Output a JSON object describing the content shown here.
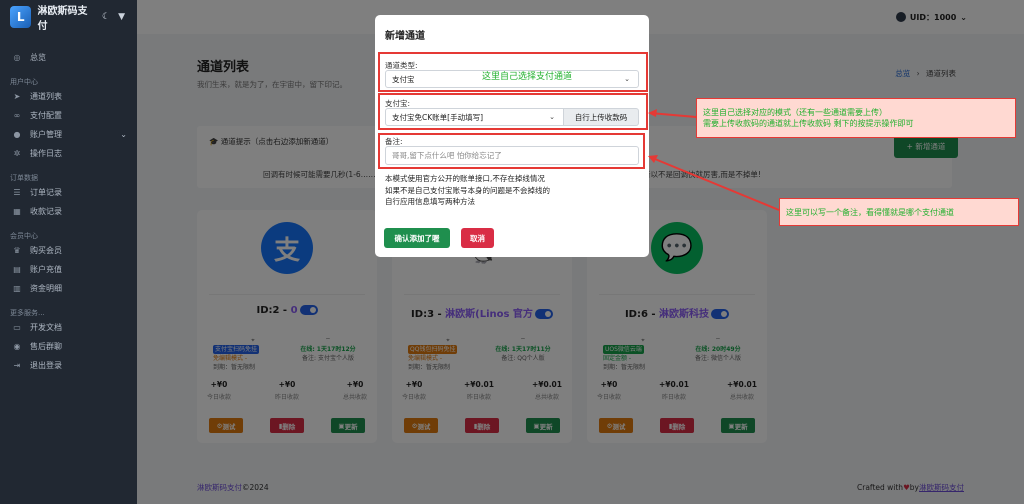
{
  "sidebar": {
    "brand": "淋欧斯码支付",
    "sections": [
      {
        "title": "用户中心",
        "items": [
          "通道列表",
          "支付配置",
          "账户管理",
          "操作日志"
        ]
      },
      {
        "title": "订单数据",
        "items": [
          "订单记录",
          "收款记录"
        ]
      },
      {
        "title": "会员中心",
        "items": [
          "购买会员",
          "账户充值",
          "资金明细"
        ]
      },
      {
        "title": "更多服务...",
        "items": [
          "开发文档",
          "售后群聊",
          "退出登录"
        ]
      }
    ],
    "home": "总览"
  },
  "topbar": {
    "uid": "UID：1000"
  },
  "page": {
    "title": "通道列表",
    "subtitle": "我们生来，就是为了，在宇宙中，留下印记。",
    "breadcrumb_home": "总览",
    "breadcrumb_current": "通道列表"
  },
  "notice": {
    "title": "通道提示（点击右边添加新通道）",
    "text": "回调有时候可能需要几秒(1-6…………………………………………………………………账号一些功能 而设定的时间,所以不是回调快就厉害,而是不掉单!",
    "add_button": "+ 新增通道"
  },
  "cards": [
    {
      "id_label": "ID:2 - ",
      "name": "0",
      "tag": "支付宝扫码免挂",
      "tag_color": "#2563eb",
      "sub1": "免编辑模式 -",
      "sub2": "到期：暂无限制",
      "online": "在线: 1天17时12分",
      "remark": "备注: 支付宝个人版",
      "today": "+¥0",
      "yesterday": "+¥0",
      "total": "+¥0",
      "logo": "支",
      "logo_color": "#1677ff"
    },
    {
      "id_label": "ID:3 - ",
      "name": "淋欧斯(Linos 官方",
      "tag": "QQ钱包扫码免挂",
      "tag_color": "#e07a0e",
      "sub1": "免编辑模式 -",
      "sub2": "到期：暂无限制",
      "online": "在线: 1天17时11分",
      "remark": "备注: QQ个人版",
      "today": "+¥0",
      "yesterday": "+¥0.01",
      "total": "+¥0.01",
      "logo": "",
      "logo_color": "#ffffff"
    },
    {
      "id_label": "ID:6 - ",
      "name": "淋欧斯科技",
      "tag": "UOS微信云端",
      "tag_color": "#16a34a",
      "sub1": "固定金额 -",
      "sub2": "到期：暂无限制",
      "online": "在线: 20时49分",
      "remark": "备注: 微信个人版",
      "today": "+¥0",
      "yesterday": "+¥0.01",
      "total": "+¥0.01",
      "logo": "",
      "logo_color": "#07c160"
    }
  ],
  "stat_labels": {
    "today": "今日收款",
    "yesterday": "昨日收款",
    "total": "总共收款"
  },
  "card_buttons": {
    "test": "测试",
    "delete": "删除",
    "update": "更新"
  },
  "footer": {
    "left_brand": "淋欧斯码支付",
    "left_year": "©2024",
    "right_prefix": "Crafted with",
    "right_heart": "♥",
    "right_by": "by",
    "right_brand": "淋欧斯码支付"
  },
  "modal": {
    "title": "新增通道",
    "type_label": "通道类型:",
    "type_value": "支付宝",
    "alipay_label": "支付宝:",
    "alipay_value": "支付宝免CK账单[手动填写]",
    "upload_button": "自行上传收款码",
    "remark_label": "备注:",
    "remark_placeholder": "哥哥,留下点什么吧 怕你给忘记了",
    "info_lines": [
      "本模式使用官方公开的账单接口,不存在掉线情况",
      "如果不是自己支付宝账号本身的问题是不会掉线的",
      "自行应用信息填写两种方法"
    ],
    "confirm_button": "确认添加了喔",
    "cancel_button": "取消"
  },
  "annotations": {
    "type_hint": "这里自己选择支付通道",
    "alipay_hint_1": "这里自己选择对应的模式（还有一些通道需要上传）",
    "alipay_hint_2": "需要上传收款码的通道就上传收款码 剩下的按提示操作即可",
    "remark_hint": "这里可以写一个备注，看得懂就是哪个支付通道"
  },
  "colors": {
    "annotation_text": "#22b02e",
    "annotation_border": "#e53935",
    "primary": "#1f8f4e",
    "danger": "#d92d45"
  }
}
